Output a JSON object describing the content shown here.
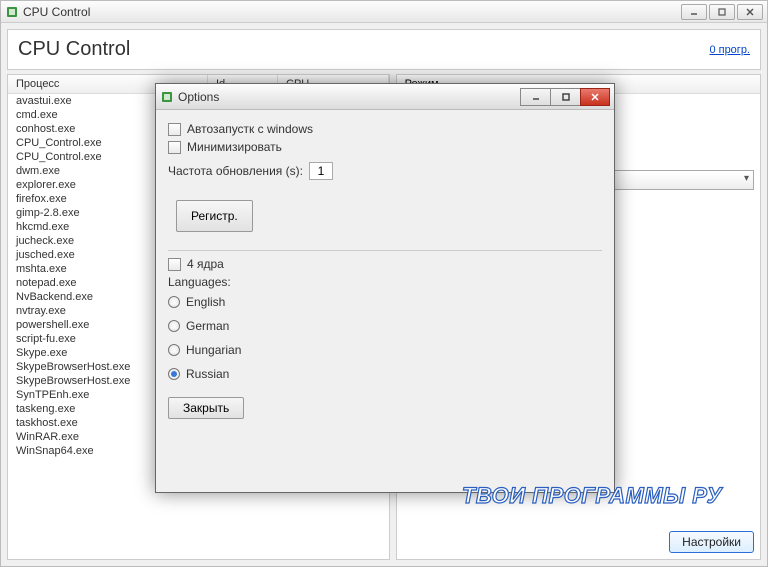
{
  "main": {
    "window_title": "CPU Control",
    "header_title": "CPU Control",
    "header_link": "0 прогр.",
    "columns": {
      "process": "Процесс",
      "id": "Id",
      "cpu": "CPU"
    },
    "mode_label": "Режим",
    "settings_button": "Настройки",
    "processes": [
      "avastui.exe",
      "cmd.exe",
      "conhost.exe",
      "CPU_Control.exe",
      "CPU_Control.exe",
      "dwm.exe",
      "explorer.exe",
      "firefox.exe",
      "gimp-2.8.exe",
      "hkcmd.exe",
      "jucheck.exe",
      "jusched.exe",
      "mshta.exe",
      "notepad.exe",
      "NvBackend.exe",
      "nvtray.exe",
      "powershell.exe",
      "script-fu.exe",
      "Skype.exe",
      "SkypeBrowserHost.exe",
      "SkypeBrowserHost.exe",
      "SynTPEnh.exe",
      "taskeng.exe",
      "taskhost.exe",
      "WinRAR.exe",
      "WinSnap64.exe"
    ]
  },
  "dialog": {
    "title": "Options",
    "autostart_label": "Автозапустк с windows",
    "minimize_label": "Минимизировать",
    "freq_label": "Частота обновления (s):",
    "freq_value": "1",
    "register_button": "Регистр.",
    "four_cores_label": "4 ядра",
    "languages_label": "Languages:",
    "languages": [
      "English",
      "German",
      "Hungarian",
      "Russian"
    ],
    "selected_language": "Russian",
    "close_button": "Закрыть"
  },
  "watermark": "ТВОИ ПРОГРАММЫ РУ"
}
